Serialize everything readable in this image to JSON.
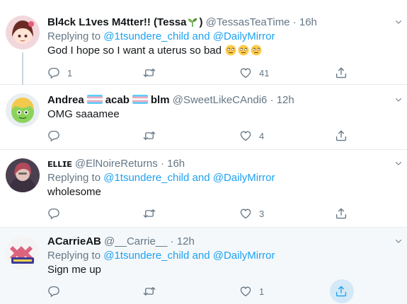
{
  "tweets": [
    {
      "name": "Bl4ck L1ves M4tter!! (Tessa",
      "name_suffix": ")",
      "handle": "@TessasTeaTime",
      "dot": "·",
      "time": "16h",
      "replying_label": "Replying to",
      "mention_1": "@1tsundere_child",
      "and_label": "and",
      "mention_2": "@DailyMirror",
      "text": "God I hope so I want a uterus so bad",
      "emojis": [
        "rolling-eyes-emoji",
        "rolling-eyes-emoji",
        "rolling-eyes-emoji"
      ],
      "replies": "1",
      "retweets": "",
      "likes": "41"
    },
    {
      "name": "Andrea",
      "name_part2": "acab",
      "name_part3": "blm",
      "handle": "@SweetLikeCAndi6",
      "dot": "·",
      "time": "12h",
      "text": "OMG saaamee",
      "replies": "",
      "retweets": "",
      "likes": "4"
    },
    {
      "name": "ᴇʟʟɪᴇ",
      "handle": "@ElNoireReturns",
      "dot": "·",
      "time": "16h",
      "replying_label": "Replying to",
      "mention_1": "@1tsundere_child",
      "and_label": "and",
      "mention_2": "@DailyMirror",
      "text": "wholesome",
      "replies": "",
      "retweets": "",
      "likes": "3"
    },
    {
      "name": "ACarrieAB",
      "handle": "@__Carrie__",
      "dot": "·",
      "time": "12h",
      "replying_label": "Replying to",
      "mention_1": "@1tsundere_child",
      "and_label": "and",
      "mention_2": "@DailyMirror",
      "text": "Sign me up",
      "replies": "",
      "retweets": "",
      "likes": "1"
    }
  ],
  "colors": {
    "link": "#1da1f2",
    "muted": "#657786",
    "text": "#14171a",
    "divider": "#e6ecf0",
    "hover_bg": "#f5f8fa"
  },
  "icons": [
    "reply-icon",
    "retweet-icon",
    "like-icon",
    "share-icon",
    "caret-down-icon",
    "seedling-emoji",
    "trans-flag-emoji"
  ]
}
